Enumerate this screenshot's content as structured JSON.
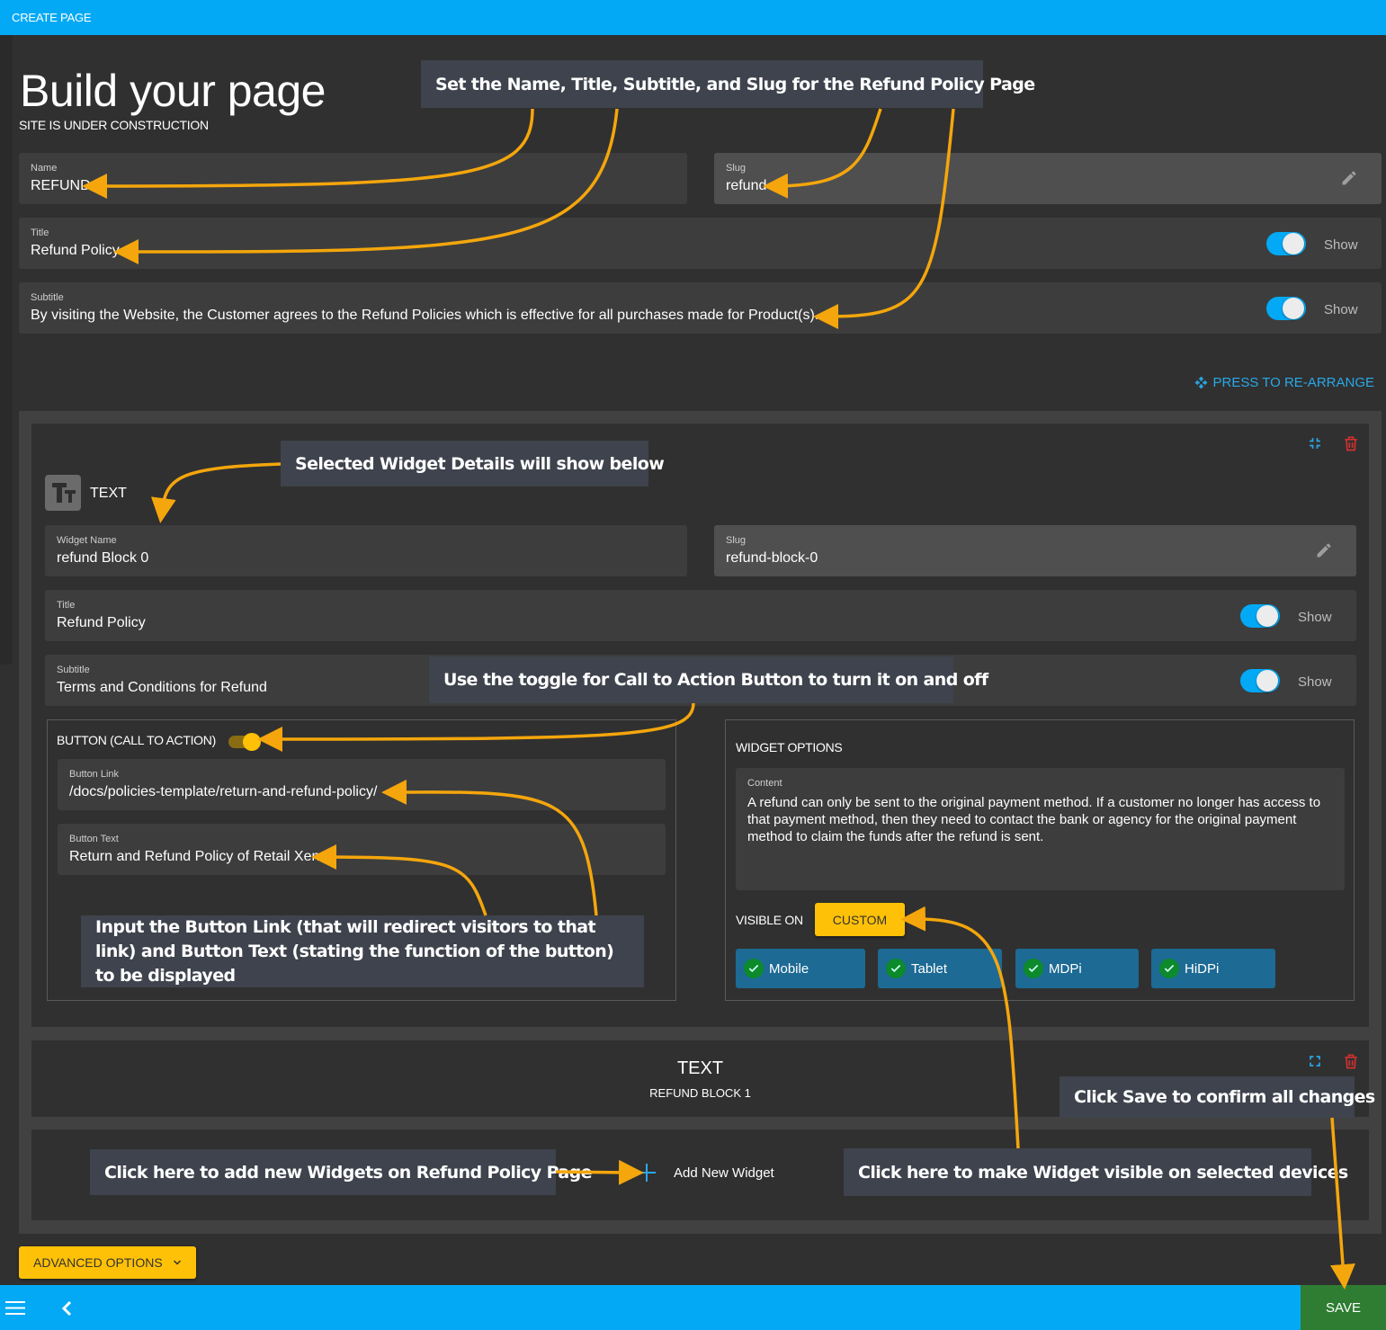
{
  "topbar": {
    "title": "CREATE PAGE"
  },
  "header": {
    "title": "Build your page",
    "subtitle": "SITE IS UNDER CONSTRUCTION"
  },
  "page_fields": {
    "name": {
      "label": "Name",
      "value": "REFUND"
    },
    "slug": {
      "label": "Slug",
      "value": "refund",
      "icon": "pencil-icon"
    },
    "title": {
      "label": "Title",
      "value": "Refund Policy",
      "toggle_on": true,
      "toggle_label": "Show"
    },
    "subtitle": {
      "label": "Subtitle",
      "value": "By visiting the Website, the Customer agrees to the Refund Policies which is effective for all purchases made for Product(s).",
      "toggle_on": true,
      "toggle_label": "Show"
    }
  },
  "rearrange": {
    "label": "PRESS TO RE-ARRANGE",
    "icon": "move-icon"
  },
  "widget": {
    "type_label": "TEXT",
    "type_icon": "text-type-icon",
    "name": {
      "label": "Widget Name",
      "value": "refund Block 0"
    },
    "slug": {
      "label": "Slug",
      "value": "refund-block-0"
    },
    "title": {
      "label": "Title",
      "value": "Refund Policy",
      "toggle_on": true,
      "toggle_label": "Show"
    },
    "subtitle": {
      "label": "Subtitle",
      "value": "Terms and Conditions for Refund",
      "toggle_on": true,
      "toggle_label": "Show"
    },
    "cta": {
      "heading": "BUTTON (CALL TO ACTION)",
      "toggle_on": true,
      "link": {
        "label": "Button Link",
        "value": "/docs/policies-template/return-and-refund-policy/"
      },
      "text": {
        "label": "Button Text",
        "value": "Return and Refund Policy of Retail Xen"
      }
    },
    "options": {
      "heading": "WIDGET OPTIONS",
      "content": {
        "label": "Content",
        "value": "A refund can only be sent to the original payment method. If a customer no longer has access to that payment method, then they need to contact the bank or agency for the original payment method to claim the funds after the refund is sent."
      },
      "visible_on_label": "VISIBLE ON",
      "visible_on_value": "CUSTOM",
      "devices": [
        {
          "label": "Mobile",
          "checked": true
        },
        {
          "label": "Tablet",
          "checked": true
        },
        {
          "label": "MDPi",
          "checked": true
        },
        {
          "label": "HiDPi",
          "checked": true
        }
      ]
    }
  },
  "collapsed_widget": {
    "type_label": "TEXT",
    "name": "REFUND BLOCK 1"
  },
  "add_widget": {
    "label": "Add New Widget"
  },
  "advanced_options": {
    "label": "ADVANCED OPTIONS"
  },
  "bottombar": {
    "save_label": "SAVE"
  },
  "annotations": {
    "set_fields": "Set the Name, Title, Subtitle, and Slug for the Refund Policy Page",
    "selected_widget": "Selected Widget Details will show below",
    "cta_toggle": "Use the toggle for Call to Action Button to turn it on and off",
    "button_inputs": "Input the Button Link (that will redirect visitors to that link) and Button Text (stating the function of the button) to be displayed",
    "add_widgets": "Click here to add new Widgets on Refund Policy Page",
    "visible_devices": "Click here to make Widget visible on selected devices",
    "save": "Click Save to confirm all changes"
  },
  "colors": {
    "primary": "#03a9f4",
    "accent": "#ffc107",
    "save": "#2e7d32",
    "device_chip": "#1d6a94",
    "delete": "#d32f2f",
    "annotation_arrow": "#f4a60c"
  }
}
